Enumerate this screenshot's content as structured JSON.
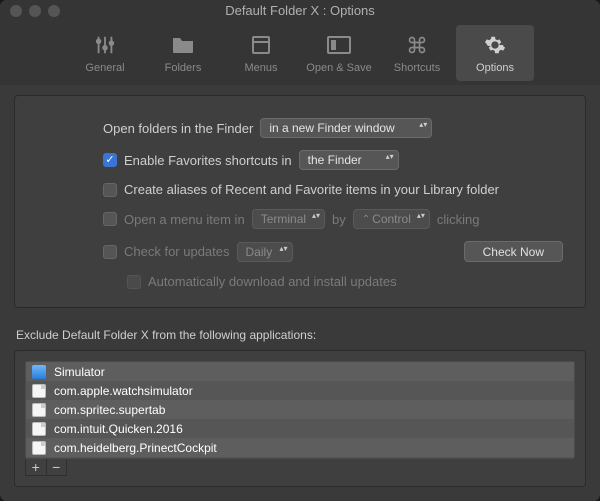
{
  "window": {
    "title": "Default Folder X : Options"
  },
  "toolbar": [
    {
      "id": "general",
      "label": "General"
    },
    {
      "id": "folders",
      "label": "Folders"
    },
    {
      "id": "menus",
      "label": "Menus"
    },
    {
      "id": "opensave",
      "label": "Open & Save"
    },
    {
      "id": "shortcuts",
      "label": "Shortcuts"
    },
    {
      "id": "options",
      "label": "Options"
    }
  ],
  "opts": {
    "open_folders_label": "Open folders in the Finder",
    "open_folders_value": "in a new Finder window",
    "enable_favorites_label": "Enable Favorites shortcuts in",
    "enable_favorites_value": "the Finder",
    "create_aliases_label": "Create aliases of Recent and Favorite items in your Library folder",
    "open_menu_item_label": "Open a menu item in",
    "open_menu_item_app": "Terminal",
    "open_menu_item_by": "by",
    "open_menu_item_mod": "Control",
    "open_menu_item_suffix": "clicking",
    "check_updates_label": "Check for updates",
    "check_updates_freq": "Daily",
    "check_now_label": "Check Now",
    "auto_download_label": "Automatically download and install updates"
  },
  "exclude": {
    "heading": "Exclude Default Folder X from the following applications:",
    "items": [
      {
        "name": "Simulator",
        "icon": "blue"
      },
      {
        "name": "com.apple.watchsimulator",
        "icon": "doc"
      },
      {
        "name": "com.spritec.supertab",
        "icon": "doc"
      },
      {
        "name": "com.intuit.Quicken.2016",
        "icon": "doc"
      },
      {
        "name": "com.heidelberg.PrinectCockpit",
        "icon": "doc"
      }
    ]
  }
}
